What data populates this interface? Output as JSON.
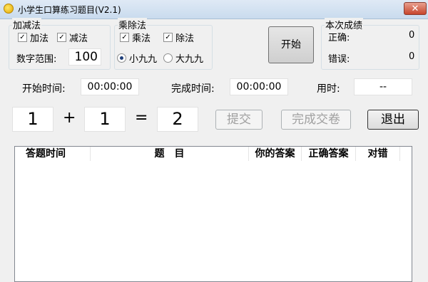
{
  "window": {
    "title": "小学生口算练习题目(V2.1)",
    "close_glyph": "✕"
  },
  "addsub": {
    "legend": "加减法",
    "add_label": "加法",
    "add_checked": true,
    "sub_label": "减法",
    "sub_checked": true,
    "range_label": "数字范围:",
    "range_value": "100"
  },
  "muldiv": {
    "legend": "乘除法",
    "mul_label": "乘法",
    "mul_checked": true,
    "div_label": "除法",
    "div_checked": true,
    "small_label": "小九九",
    "small_selected": true,
    "big_label": "大九九",
    "big_selected": false
  },
  "start_button": "开始",
  "score": {
    "legend": "本次成绩",
    "correct_label": "正确:",
    "correct_value": "0",
    "wrong_label": "错误:",
    "wrong_value": "0"
  },
  "timing": {
    "start_label": "开始时间:",
    "start_value": "00:00:00",
    "finish_label": "完成时间:",
    "finish_value": "00:00:00",
    "elapsed_label": "用时:",
    "elapsed_value": "--"
  },
  "question": {
    "operand1": "1",
    "operator": "+",
    "operand2": "1",
    "equals": "=",
    "answer": "2"
  },
  "buttons": {
    "submit": "提交",
    "finish": "完成交卷",
    "exit": "退出"
  },
  "table": {
    "columns": [
      "答题时间",
      "题　目",
      "你的答案",
      "正确答案",
      "对错"
    ]
  }
}
